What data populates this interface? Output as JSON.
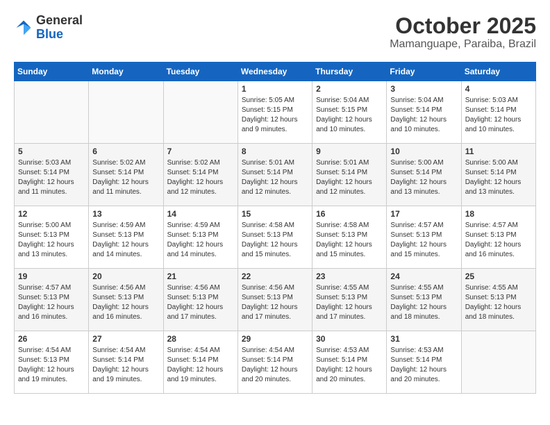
{
  "logo": {
    "general": "General",
    "blue": "Blue"
  },
  "header": {
    "month": "October 2025",
    "location": "Mamanguape, Paraiba, Brazil"
  },
  "weekdays": [
    "Sunday",
    "Monday",
    "Tuesday",
    "Wednesday",
    "Thursday",
    "Friday",
    "Saturday"
  ],
  "weeks": [
    [
      {
        "day": "",
        "info": ""
      },
      {
        "day": "",
        "info": ""
      },
      {
        "day": "",
        "info": ""
      },
      {
        "day": "1",
        "info": "Sunrise: 5:05 AM\nSunset: 5:15 PM\nDaylight: 12 hours\nand 9 minutes."
      },
      {
        "day": "2",
        "info": "Sunrise: 5:04 AM\nSunset: 5:15 PM\nDaylight: 12 hours\nand 10 minutes."
      },
      {
        "day": "3",
        "info": "Sunrise: 5:04 AM\nSunset: 5:14 PM\nDaylight: 12 hours\nand 10 minutes."
      },
      {
        "day": "4",
        "info": "Sunrise: 5:03 AM\nSunset: 5:14 PM\nDaylight: 12 hours\nand 10 minutes."
      }
    ],
    [
      {
        "day": "5",
        "info": "Sunrise: 5:03 AM\nSunset: 5:14 PM\nDaylight: 12 hours\nand 11 minutes."
      },
      {
        "day": "6",
        "info": "Sunrise: 5:02 AM\nSunset: 5:14 PM\nDaylight: 12 hours\nand 11 minutes."
      },
      {
        "day": "7",
        "info": "Sunrise: 5:02 AM\nSunset: 5:14 PM\nDaylight: 12 hours\nand 12 minutes."
      },
      {
        "day": "8",
        "info": "Sunrise: 5:01 AM\nSunset: 5:14 PM\nDaylight: 12 hours\nand 12 minutes."
      },
      {
        "day": "9",
        "info": "Sunrise: 5:01 AM\nSunset: 5:14 PM\nDaylight: 12 hours\nand 12 minutes."
      },
      {
        "day": "10",
        "info": "Sunrise: 5:00 AM\nSunset: 5:14 PM\nDaylight: 12 hours\nand 13 minutes."
      },
      {
        "day": "11",
        "info": "Sunrise: 5:00 AM\nSunset: 5:14 PM\nDaylight: 12 hours\nand 13 minutes."
      }
    ],
    [
      {
        "day": "12",
        "info": "Sunrise: 5:00 AM\nSunset: 5:13 PM\nDaylight: 12 hours\nand 13 minutes."
      },
      {
        "day": "13",
        "info": "Sunrise: 4:59 AM\nSunset: 5:13 PM\nDaylight: 12 hours\nand 14 minutes."
      },
      {
        "day": "14",
        "info": "Sunrise: 4:59 AM\nSunset: 5:13 PM\nDaylight: 12 hours\nand 14 minutes."
      },
      {
        "day": "15",
        "info": "Sunrise: 4:58 AM\nSunset: 5:13 PM\nDaylight: 12 hours\nand 15 minutes."
      },
      {
        "day": "16",
        "info": "Sunrise: 4:58 AM\nSunset: 5:13 PM\nDaylight: 12 hours\nand 15 minutes."
      },
      {
        "day": "17",
        "info": "Sunrise: 4:57 AM\nSunset: 5:13 PM\nDaylight: 12 hours\nand 15 minutes."
      },
      {
        "day": "18",
        "info": "Sunrise: 4:57 AM\nSunset: 5:13 PM\nDaylight: 12 hours\nand 16 minutes."
      }
    ],
    [
      {
        "day": "19",
        "info": "Sunrise: 4:57 AM\nSunset: 5:13 PM\nDaylight: 12 hours\nand 16 minutes."
      },
      {
        "day": "20",
        "info": "Sunrise: 4:56 AM\nSunset: 5:13 PM\nDaylight: 12 hours\nand 16 minutes."
      },
      {
        "day": "21",
        "info": "Sunrise: 4:56 AM\nSunset: 5:13 PM\nDaylight: 12 hours\nand 17 minutes."
      },
      {
        "day": "22",
        "info": "Sunrise: 4:56 AM\nSunset: 5:13 PM\nDaylight: 12 hours\nand 17 minutes."
      },
      {
        "day": "23",
        "info": "Sunrise: 4:55 AM\nSunset: 5:13 PM\nDaylight: 12 hours\nand 17 minutes."
      },
      {
        "day": "24",
        "info": "Sunrise: 4:55 AM\nSunset: 5:13 PM\nDaylight: 12 hours\nand 18 minutes."
      },
      {
        "day": "25",
        "info": "Sunrise: 4:55 AM\nSunset: 5:13 PM\nDaylight: 12 hours\nand 18 minutes."
      }
    ],
    [
      {
        "day": "26",
        "info": "Sunrise: 4:54 AM\nSunset: 5:13 PM\nDaylight: 12 hours\nand 19 minutes."
      },
      {
        "day": "27",
        "info": "Sunrise: 4:54 AM\nSunset: 5:14 PM\nDaylight: 12 hours\nand 19 minutes."
      },
      {
        "day": "28",
        "info": "Sunrise: 4:54 AM\nSunset: 5:14 PM\nDaylight: 12 hours\nand 19 minutes."
      },
      {
        "day": "29",
        "info": "Sunrise: 4:54 AM\nSunset: 5:14 PM\nDaylight: 12 hours\nand 20 minutes."
      },
      {
        "day": "30",
        "info": "Sunrise: 4:53 AM\nSunset: 5:14 PM\nDaylight: 12 hours\nand 20 minutes."
      },
      {
        "day": "31",
        "info": "Sunrise: 4:53 AM\nSunset: 5:14 PM\nDaylight: 12 hours\nand 20 minutes."
      },
      {
        "day": "",
        "info": ""
      }
    ]
  ]
}
